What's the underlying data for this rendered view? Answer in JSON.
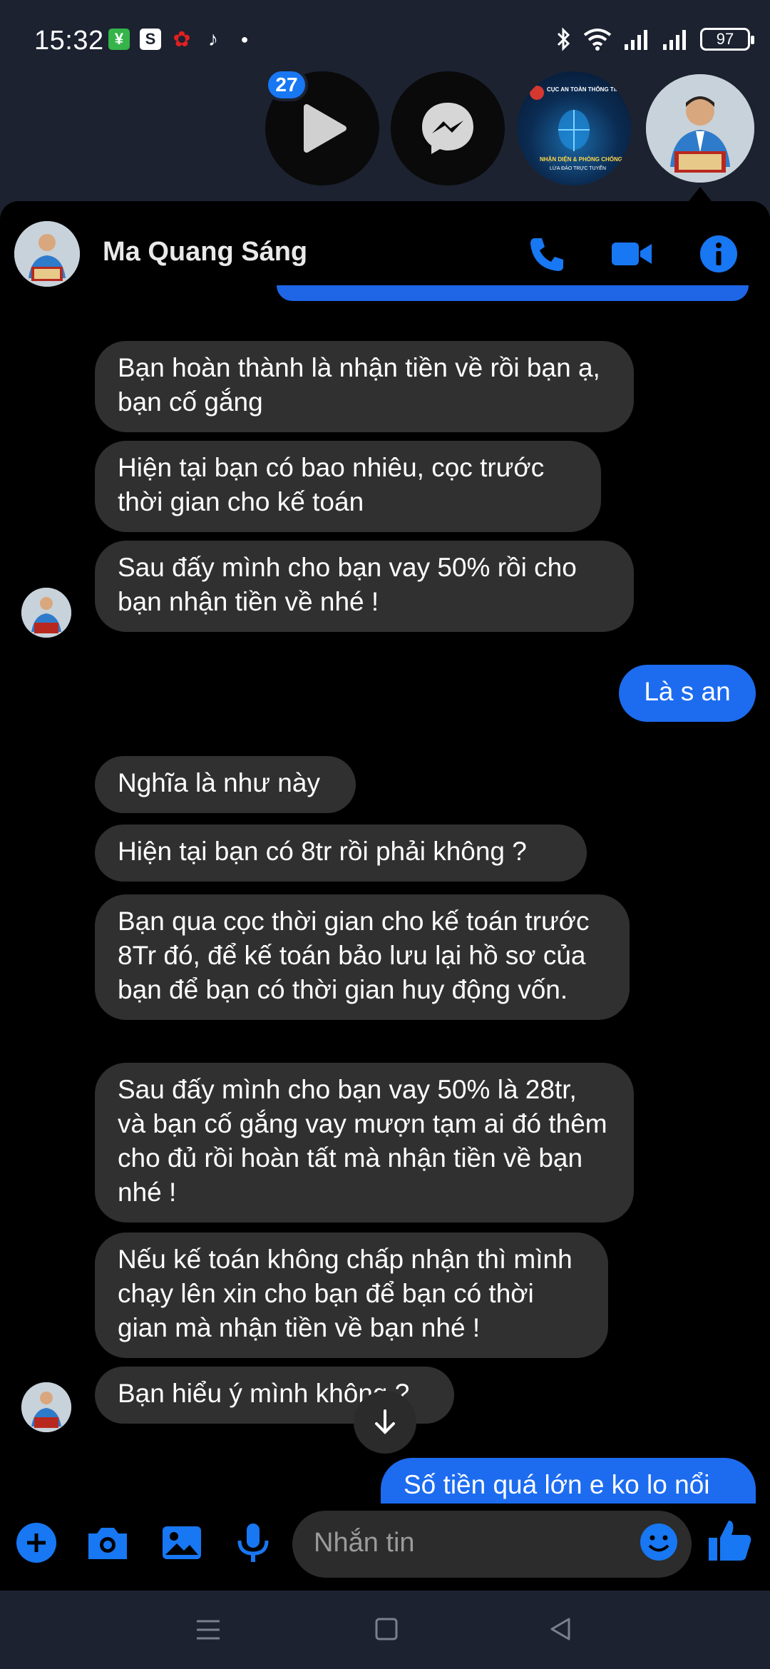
{
  "status_bar": {
    "time": "15:32",
    "battery": "97",
    "notification_icons": [
      "money-app-icon",
      "shopping-bag-icon",
      "huawei-icon",
      "tiktok-icon",
      "dot-icon"
    ],
    "system_icons": [
      "bluetooth-icon",
      "wifi-icon",
      "signal-1-icon",
      "signal-2-icon"
    ]
  },
  "chat_heads": {
    "badge_count": "27",
    "cuc_logo_text": "CỤC AN TOÀN THÔNG TIN",
    "cuc_logo_sub": "NHẬN DIỆN & PHÒNG CHỐNG",
    "cuc_logo_sub2": "LỪA ĐẢO TRỰC TUYẾN"
  },
  "header": {
    "name": "Ma Quang Sáng"
  },
  "messages": [
    {
      "side": "them",
      "text": "Bạn hoàn thành là nhận tiền về rồi bạn ạ, bạn cố gắng"
    },
    {
      "side": "them",
      "text": "Hiện tại bạn có bao nhiêu, cọc trước thời gian cho kế toán"
    },
    {
      "side": "them",
      "text": "Sau đấy mình cho bạn vay 50% rồi cho bạn nhận tiền về nhé !"
    },
    {
      "side": "me",
      "text": "Là s an"
    },
    {
      "side": "them",
      "text": "Nghĩa là như này"
    },
    {
      "side": "them",
      "text": "Hiện tại bạn có 8tr rồi phải không ?"
    },
    {
      "side": "them",
      "text": "Bạn qua cọc thời gian cho kế toán trước 8Tr đó, để kế toán bảo lưu lại hồ sơ của bạn để bạn có thời gian huy động vốn."
    },
    {
      "side": "them",
      "text": "Sau đấy mình cho bạn vay 50% là 28tr, và bạn cố gắng vay mượn tạm ai đó thêm cho đủ rồi hoàn tất mà nhận tiền về bạn nhé !"
    },
    {
      "side": "them",
      "text": "Nếu kế toán không chấp nhận thì mình chạy lên xin cho bạn để bạn có thời gian mà nhận tiền về bạn nhé !"
    },
    {
      "side": "them",
      "text": "Bạn hiểu ý mình không ?"
    },
    {
      "side": "me",
      "text": "Số tiền quá lớn e ko lo nổi"
    }
  ],
  "composer": {
    "placeholder": "Nhắn tin"
  },
  "colors": {
    "accent": "#1877f2",
    "my_bubble": "#1d6cf0",
    "their_bubble": "#303030",
    "panel_bg": "#000000",
    "backdrop": "#1c2230"
  }
}
